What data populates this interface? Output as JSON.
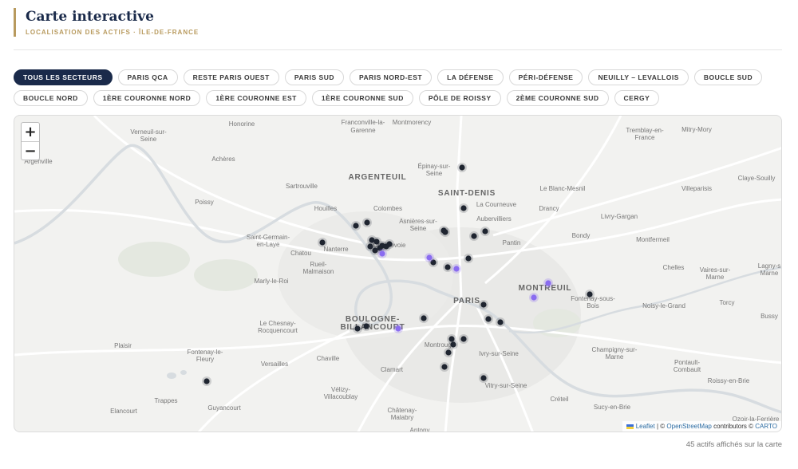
{
  "header": {
    "title": "Carte interactive",
    "subtitle": "LOCALISATION DES ACTIFS · ÎLE-DE-FRANCE"
  },
  "filters": [
    {
      "label": "TOUS LES SECTEURS",
      "active": true
    },
    {
      "label": "PARIS QCA",
      "active": false
    },
    {
      "label": "RESTE PARIS OUEST",
      "active": false
    },
    {
      "label": "PARIS SUD",
      "active": false
    },
    {
      "label": "PARIS NORD-EST",
      "active": false
    },
    {
      "label": "LA DÉFENSE",
      "active": false
    },
    {
      "label": "PÉRI-DÉFENSE",
      "active": false
    },
    {
      "label": "NEUILLY – LEVALLOIS",
      "active": false
    },
    {
      "label": "BOUCLE SUD",
      "active": false
    },
    {
      "label": "BOUCLE NORD",
      "active": false
    },
    {
      "label": "1ÈRE COURONNE NORD",
      "active": false
    },
    {
      "label": "1ÈRE COURONNE EST",
      "active": false
    },
    {
      "label": "1ÈRE COURONNE SUD",
      "active": false
    },
    {
      "label": "PÔLE DE ROISSY",
      "active": false
    },
    {
      "label": "2ÈME COURONNE SUD",
      "active": false
    },
    {
      "label": "CERGY",
      "active": false
    }
  ],
  "map": {
    "zoom_in": "+",
    "zoom_out": "−",
    "attribution": {
      "leaflet": "Leaflet",
      "sep": "| ©",
      "osm": "OpenStreetMap",
      "contrib": "contributors ©",
      "carto": "CARTO"
    },
    "colors": {
      "marker": "#1f2530",
      "marker_highlight": "#8a6cf0",
      "water": "#d7dce0",
      "road": "#ffffff"
    },
    "places": [
      {
        "name": "Honorine",
        "big": false
      },
      {
        "name": "Franconville-la-",
        "big": false
      },
      {
        "name": "Garenne",
        "big": false
      },
      {
        "name": "Montmorency",
        "big": false
      },
      {
        "name": "Tremblay-en-",
        "big": false
      },
      {
        "name": "France",
        "big": false
      },
      {
        "name": "Mitry-Mory",
        "big": false
      },
      {
        "name": "Verneuil-sur-",
        "big": false
      },
      {
        "name": "Seine",
        "big": false
      },
      {
        "name": "Argenville",
        "big": false
      },
      {
        "name": "Achères",
        "big": false
      },
      {
        "name": "Épinay-sur-",
        "big": false
      },
      {
        "name": "Seine",
        "big": false
      },
      {
        "name": "ARGENTEUIL",
        "big": true
      },
      {
        "name": "Sartrouville",
        "big": false
      },
      {
        "name": "SAINT-DENIS",
        "big": true
      },
      {
        "name": "Le Blanc-Mesnil",
        "big": false
      },
      {
        "name": "Claye-Souilly",
        "big": false
      },
      {
        "name": "Villeparisis",
        "big": false
      },
      {
        "name": "Poissy",
        "big": false
      },
      {
        "name": "La Courneuve",
        "big": false
      },
      {
        "name": "Drancy",
        "big": false
      },
      {
        "name": "Houilles",
        "big": false
      },
      {
        "name": "Colombes",
        "big": false
      },
      {
        "name": "Aubervilliers",
        "big": false
      },
      {
        "name": "Livry-Gargan",
        "big": false
      },
      {
        "name": "Asnières-sur-",
        "big": false
      },
      {
        "name": "Seine",
        "big": false
      },
      {
        "name": "Saint-Germain-",
        "big": false
      },
      {
        "name": "en-Laye",
        "big": false
      },
      {
        "name": "Bondy",
        "big": false
      },
      {
        "name": "Nanterre",
        "big": false
      },
      {
        "name": "Courbevoie",
        "big": false
      },
      {
        "name": "Pantin",
        "big": false
      },
      {
        "name": "Montfermeil",
        "big": false
      },
      {
        "name": "Chatou",
        "big": false
      },
      {
        "name": "Rueil-",
        "big": false
      },
      {
        "name": "Malmaison",
        "big": false
      },
      {
        "name": "Chelles",
        "big": false
      },
      {
        "name": "Vaires-sur-",
        "big": false
      },
      {
        "name": "Marne",
        "big": false
      },
      {
        "name": "Lagny-s",
        "big": false
      },
      {
        "name": "Marne",
        "big": false
      },
      {
        "name": "Marly-le-Roi",
        "big": false
      },
      {
        "name": "MONTREUIL",
        "big": true
      },
      {
        "name": "PARIS",
        "big": true
      },
      {
        "name": "Fontenay-sous-",
        "big": false
      },
      {
        "name": "Bois",
        "big": false
      },
      {
        "name": "Noisy-le-Grand",
        "big": false
      },
      {
        "name": "Torcy",
        "big": false
      },
      {
        "name": "BOULOGNE-",
        "big": true
      },
      {
        "name": "BILLANCOURT",
        "big": true
      },
      {
        "name": "Bussy",
        "big": false
      },
      {
        "name": "Le Chesnay-",
        "big": false
      },
      {
        "name": "Rocquencourt",
        "big": false
      },
      {
        "name": "Plaisir",
        "big": false
      },
      {
        "name": "Montrouge",
        "big": false
      },
      {
        "name": "Ivry-sur-Seine",
        "big": false
      },
      {
        "name": "Champigny-sur-",
        "big": false
      },
      {
        "name": "Marne",
        "big": false
      },
      {
        "name": "Fontenay-le-",
        "big": false
      },
      {
        "name": "Fleury",
        "big": false
      },
      {
        "name": "Versailles",
        "big": false
      },
      {
        "name": "Chaville",
        "big": false
      },
      {
        "name": "Clamart",
        "big": false
      },
      {
        "name": "Pontault-",
        "big": false
      },
      {
        "name": "Combault",
        "big": false
      },
      {
        "name": "Vitry-sur-Seine",
        "big": false
      },
      {
        "name": "Roissy-en-Brie",
        "big": false
      },
      {
        "name": "Vélizy-",
        "big": false
      },
      {
        "name": "Villacoublay",
        "big": false
      },
      {
        "name": "Trappes",
        "big": false
      },
      {
        "name": "Guyancourt",
        "big": false
      },
      {
        "name": "Créteil",
        "big": false
      },
      {
        "name": "Sucy-en-Brie",
        "big": false
      },
      {
        "name": "Elancourt",
        "big": false
      },
      {
        "name": "Châtenay-",
        "big": false
      },
      {
        "name": "Malabry",
        "big": false
      },
      {
        "name": "Ozoir-la-Ferrière",
        "big": false
      },
      {
        "name": "Antony",
        "big": false
      }
    ]
  },
  "footer": {
    "count_text": "45 actifs affichés sur la carte"
  }
}
